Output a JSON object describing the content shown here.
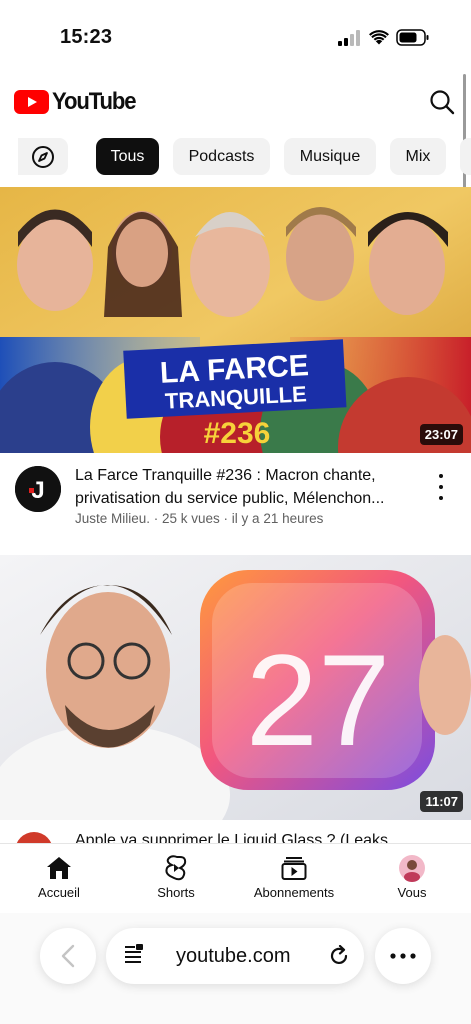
{
  "status_bar": {
    "time": "15:23"
  },
  "header": {
    "logo_text": "YouTube",
    "brand_color": "#ff0000"
  },
  "chips": [
    {
      "label": "Tous",
      "active": true
    },
    {
      "label": "Podcasts",
      "active": false
    },
    {
      "label": "Musique",
      "active": false
    },
    {
      "label": "Mix",
      "active": false
    }
  ],
  "videos": [
    {
      "thumbnail_text_line1": "LA FARCE",
      "thumbnail_text_line2": "TRANQUILLE",
      "thumbnail_number": "#236",
      "duration": "23:07",
      "channel_avatar_letter": "J",
      "title": "La Farce Tranquille #236 : Macron chante, privatisation du service public, Mélenchon...",
      "meta": "Juste Milieu. · 25 k vues · il y a 21 heures"
    },
    {
      "thumbnail_number": "27",
      "duration": "11:07",
      "title_partial": "Apple va supprimer le Liquid Glass ? (Leaks"
    }
  ],
  "bottom_nav": {
    "home": "Accueil",
    "shorts": "Shorts",
    "subscriptions": "Abonnements",
    "you": "Vous"
  },
  "browser": {
    "url": "youtube.com"
  }
}
